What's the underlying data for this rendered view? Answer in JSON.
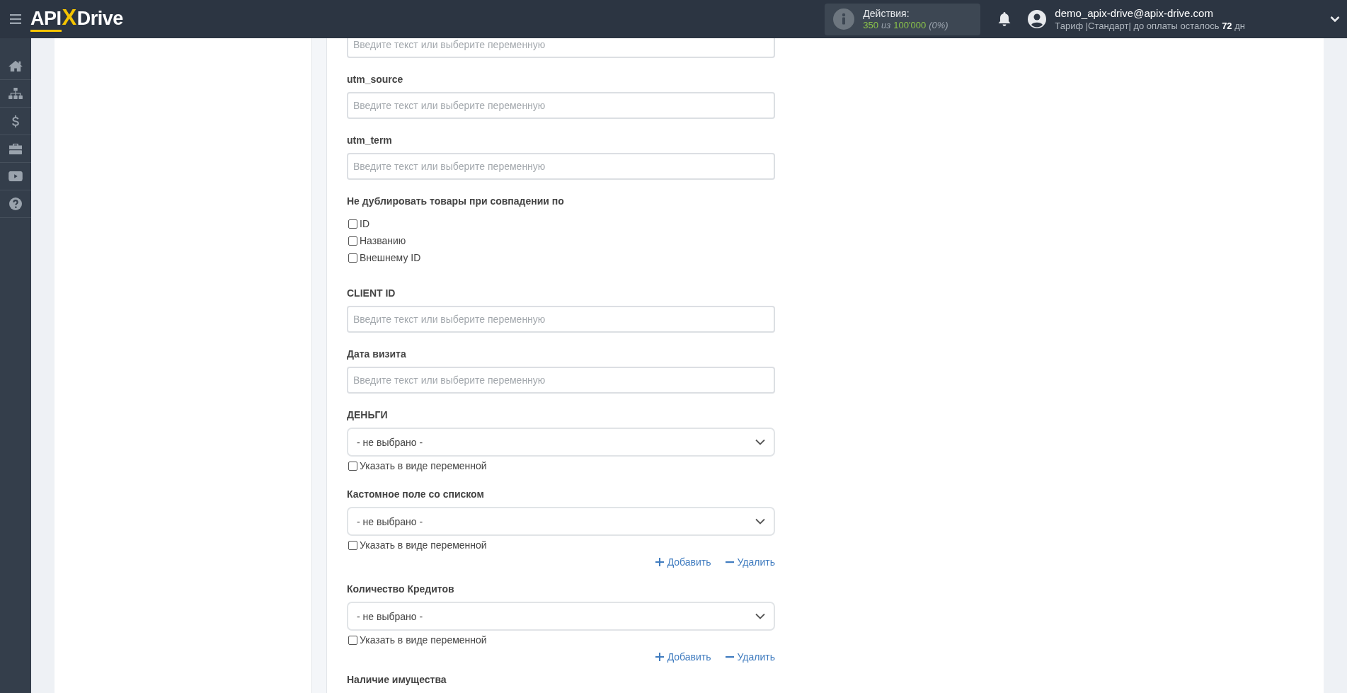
{
  "header": {
    "logo": {
      "left": "API",
      "mark": "X",
      "right": "Drive"
    },
    "actions": {
      "label": "Действия:",
      "used": "350",
      "of": "из",
      "total": "100'000",
      "percent": "(0%)"
    },
    "user": {
      "email": "demo_apix-drive@apix-drive.com",
      "plan": "Тариф |Стандарт| до оплаты осталось **72** дн"
    }
  },
  "form": {
    "fields": [
      {
        "kind": "text",
        "placeholder": "Введите текст или выберите переменную"
      },
      {
        "kind": "text",
        "label": "utm_source",
        "placeholder": "Введите текст или выберите переменную"
      },
      {
        "kind": "text",
        "label": "utm_term",
        "placeholder": "Введите текст или выберите переменную"
      },
      {
        "kind": "checkgroup",
        "label": "Не дублировать товары при совпадении по",
        "options": [
          {
            "label": "ID",
            "checked": false
          },
          {
            "label": "Названию",
            "checked": false
          },
          {
            "label": "Внешнему ID",
            "checked": false
          }
        ]
      },
      {
        "kind": "text",
        "label": "CLIENT ID",
        "placeholder": "Введите текст или выберите переменную"
      },
      {
        "kind": "text",
        "label": "Дата визита",
        "placeholder": "Введите текст или выберите переменную"
      },
      {
        "kind": "select",
        "label": "ДЕНЬГИ",
        "value": "- не выбрано -",
        "variable": {
          "label": "Указать в виде переменной",
          "checked": false
        }
      },
      {
        "kind": "select",
        "label": "Кастомное поле со списком",
        "value": "- не выбрано -",
        "variable": {
          "label": "Указать в виде переменной",
          "checked": false
        },
        "actions": [
          {
            "kind": "add",
            "label": "Добавить"
          },
          {
            "kind": "remove",
            "label": "Удалить"
          }
        ]
      },
      {
        "kind": "select",
        "label": "Количество Кредитов",
        "value": "- не выбрано -",
        "variable": {
          "label": "Указать в виде переменной",
          "checked": false
        },
        "actions": [
          {
            "kind": "add",
            "label": "Добавить"
          },
          {
            "kind": "remove",
            "label": "Удалить"
          }
        ]
      },
      {
        "kind": "label",
        "label": "Наличие имущества"
      }
    ]
  }
}
